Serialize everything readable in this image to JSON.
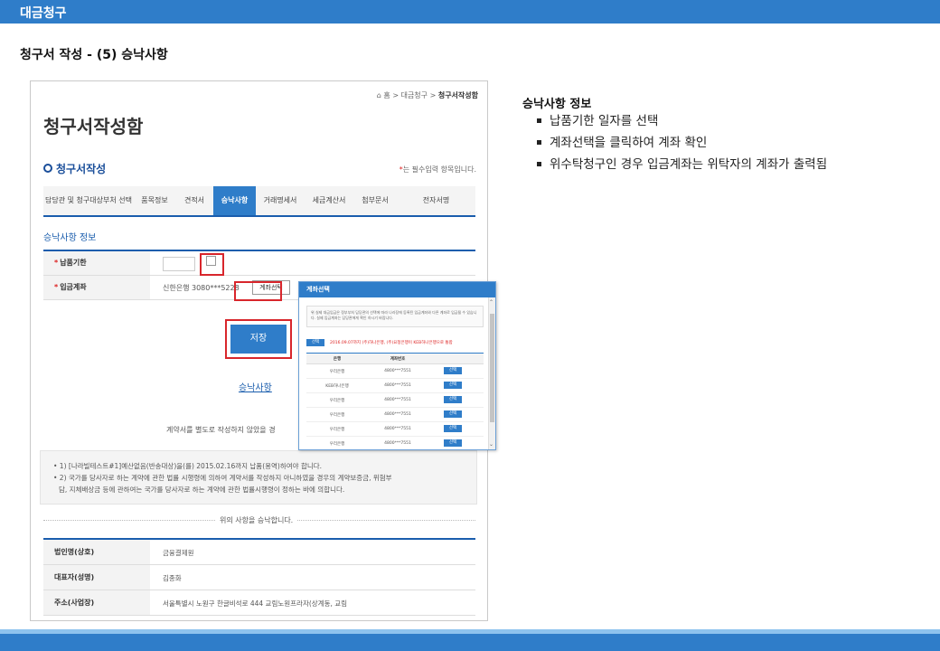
{
  "header": {
    "title": "대금청구"
  },
  "subtitle": "청구서 작성 - (5) 승낙사항",
  "screenshot": {
    "breadcrumb": {
      "home": "홈",
      "sep1": ">",
      "item1": "대금청구",
      "sep2": ">",
      "current": "청구서작성함"
    },
    "page_title": "청구서작성함",
    "section_title": "청구서작성",
    "required_star": "*",
    "required_text": "는 필수입력 항목입니다.",
    "tabs": [
      {
        "label": "담당관 및 청구대상부처 선택"
      },
      {
        "label": "품목정보"
      },
      {
        "label": "견적서"
      },
      {
        "label": "승낙사항",
        "active": true
      },
      {
        "label": "거래명세서"
      },
      {
        "label": "세금계산서"
      },
      {
        "label": "첨부문서"
      },
      {
        "label": "전자서명"
      }
    ],
    "info_title": "승낙사항 정보",
    "form": {
      "due_label": "납품기한",
      "account_label": "입금계좌",
      "account_value": "신한은행 3080***5228",
      "account_button": "계좌선택"
    },
    "save_button": "저장",
    "consent_link": "승낙사항",
    "contract_note": "계약서를 별도로 작성하지 않았을 경",
    "notes": [
      "• 1) [나라빌테스트#1]예산없음(반송대상)을(를) 2015.02.16까지 납품(용역)하여야 합니다.",
      "• 2) 국가를 당사자로 하는 계약에 관한 법률 시행령에 의하여 계약서를 작성하지 아니하였을 경우의 계약보증금, 위험부",
      "담, 지체배상금 등에 관하여는 국가를 당사자로 하는 계약에 관한 법률시행령이 정하는 바에 의합니다."
    ],
    "agree_text": "위의 사항을 승낙합니다.",
    "bottom_table": [
      {
        "label": "법인명(상호)",
        "value": "금융결제원"
      },
      {
        "label": "대표자(성명)",
        "value": "김종화"
      },
      {
        "label": "주소(사업장)",
        "value": "서울특별시 노원구 한글비석로 444 교림노원프라자(상계동, 교림"
      }
    ],
    "popup": {
      "title": "계좌선택",
      "notice": "위 실제 대금입금은 정부부처 담당관의 선택에 따라 나라장에 등록된 입금계좌와 다른 계좌로 입금될 수 있습니다. 실제 입금계좌는 담당관에게 확인 하시기 바랍니다.",
      "select_button": "선택",
      "select_text": "2016.09.07까지 (주)하나은행, (주)요청은행이 KEB하나은행으로 통합",
      "col_bank": "은행",
      "col_account": "계좌번호",
      "rows": [
        {
          "bank": "우리은행",
          "account": "4800***7551",
          "button": "선택"
        },
        {
          "bank": "KEB하나은행",
          "account": "4800***7551",
          "button": "선택"
        },
        {
          "bank": "우리은행",
          "account": "4800***7551",
          "button": "선택"
        },
        {
          "bank": "우리은행",
          "account": "4800***7551",
          "button": "선택"
        },
        {
          "bank": "우리은행",
          "account": "4800***7551",
          "button": "선택"
        },
        {
          "bank": "우리은행",
          "account": "4800***7551",
          "button": "선택"
        }
      ]
    }
  },
  "right_panel": {
    "title": "승낙사항 정보",
    "items": [
      "납품기한 일자를 선택",
      "계좌선택을 클릭하여 계좌 확인",
      "위수탁청구인 경우 입금계좌는 위탁자의 계좌가 출력됨"
    ]
  },
  "colors": {
    "brand_blue": "#2f7dc9",
    "highlight_red": "#d8262c"
  }
}
